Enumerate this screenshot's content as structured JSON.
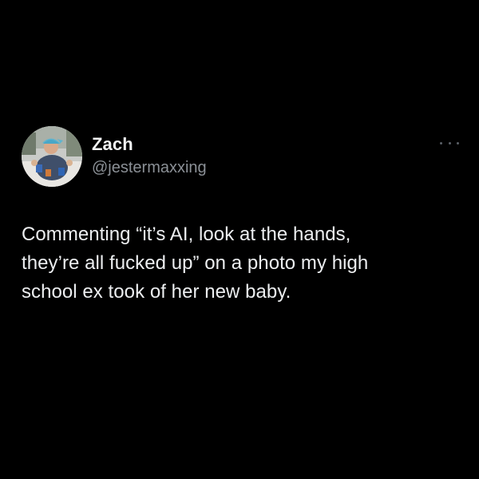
{
  "tweet": {
    "author": {
      "name": "Zach",
      "handle": "@jestermaxxing",
      "avatar_icon": "profile-photo"
    },
    "more_icon": "more-options-icon",
    "text": "Commenting “it’s AI, look at the hands,\nthey’re all fucked up” on a photo my high\nschool ex took of her new baby."
  },
  "colors": {
    "background": "#000000",
    "text_primary": "#e7e9ea",
    "text_secondary": "#8b9096"
  }
}
